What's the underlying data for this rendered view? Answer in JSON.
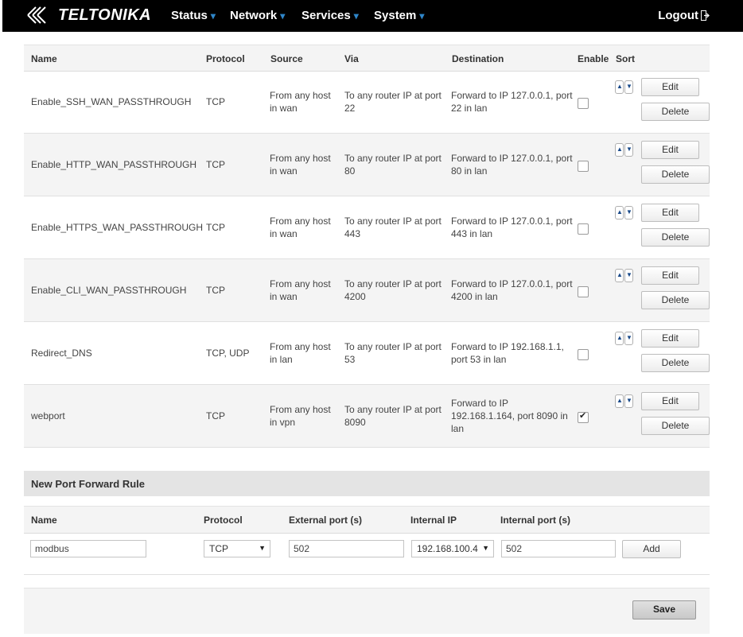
{
  "header": {
    "brand": "TELTONIKA",
    "menu": [
      {
        "label": "Status",
        "caret": "▾"
      },
      {
        "label": "Network",
        "caret": "▾"
      },
      {
        "label": "Services",
        "caret": "▾"
      },
      {
        "label": "System",
        "caret": "▾"
      }
    ],
    "logout": "Logout"
  },
  "rules": {
    "columns": [
      "Name",
      "Protocol",
      "Source",
      "Via",
      "Destination",
      "Enable",
      "Sort"
    ],
    "edit_label": "Edit",
    "delete_label": "Delete",
    "rows": [
      {
        "name": "Enable_SSH_WAN_PASSTHROUGH",
        "protocol": "TCP",
        "source": [
          "From any host",
          "in wan"
        ],
        "via": [
          "To any router IP at port",
          "22"
        ],
        "destination": [
          "Forward to IP 127.0.0.1, port",
          "22 in lan"
        ],
        "enabled": false
      },
      {
        "name": "Enable_HTTP_WAN_PASSTHROUGH",
        "protocol": "TCP",
        "source": [
          "From any host",
          "in wan"
        ],
        "via": [
          "To any router IP at port",
          "80"
        ],
        "destination": [
          "Forward to IP 127.0.0.1, port",
          "80 in lan"
        ],
        "enabled": false
      },
      {
        "name": "Enable_HTTPS_WAN_PASSTHROUGH",
        "protocol": "TCP",
        "source": [
          "From any host",
          "in wan"
        ],
        "via": [
          "To any router IP at port",
          "443"
        ],
        "destination": [
          "Forward to IP 127.0.0.1, port",
          "443 in lan"
        ],
        "enabled": false
      },
      {
        "name": "Enable_CLI_WAN_PASSTHROUGH",
        "protocol": "TCP",
        "source": [
          "From any host",
          "in wan"
        ],
        "via": [
          "To any router IP at port",
          "4200"
        ],
        "destination": [
          "Forward to IP 127.0.0.1, port",
          "4200 in lan"
        ],
        "enabled": false
      },
      {
        "name": "Redirect_DNS",
        "protocol": "TCP, UDP",
        "source": [
          "From any host",
          "in lan"
        ],
        "via": [
          "To any router IP at port",
          "53"
        ],
        "destination": [
          "Forward to IP 192.168.1.1,",
          "port 53 in lan"
        ],
        "enabled": false
      },
      {
        "name": "webport",
        "protocol": "TCP",
        "source": [
          "From any host",
          "in vpn"
        ],
        "via": [
          "To any router IP at port",
          "8090"
        ],
        "destination": [
          "Forward to IP",
          "192.168.1.164, port 8090 in",
          "lan"
        ],
        "enabled": true
      }
    ]
  },
  "new_rule": {
    "title": "New Port Forward Rule",
    "columns": [
      "Name",
      "Protocol",
      "External port (s)",
      "Internal IP",
      "Internal port (s)"
    ],
    "name_value": "modbus",
    "protocol_value": "TCP",
    "external_port_value": "502",
    "internal_ip_value": "192.168.100.4",
    "internal_port_value": "502",
    "add_label": "Add"
  },
  "footer": {
    "save_label": "Save"
  },
  "colors": {
    "topbar": "#000000",
    "caret": "#2f86c9",
    "row_alt": "#f4f4f4"
  }
}
